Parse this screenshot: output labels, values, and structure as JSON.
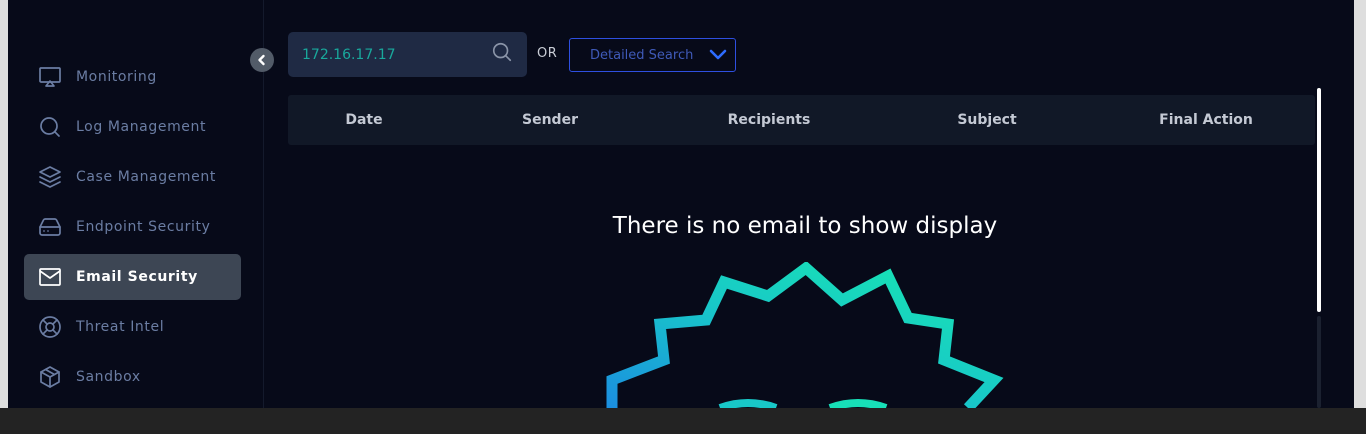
{
  "sidebar": {
    "items": [
      {
        "label": "Monitoring",
        "icon": "monitor-icon",
        "active": false
      },
      {
        "label": "Log Management",
        "icon": "search-icon",
        "active": false
      },
      {
        "label": "Case Management",
        "icon": "layers-icon",
        "active": false
      },
      {
        "label": "Endpoint Security",
        "icon": "hard-drive-icon",
        "active": false
      },
      {
        "label": "Email Security",
        "icon": "mail-icon",
        "active": true
      },
      {
        "label": "Threat Intel",
        "icon": "lifebuoy-icon",
        "active": false
      },
      {
        "label": "Sandbox",
        "icon": "box-icon",
        "active": false
      }
    ],
    "collapse_icon": "chevron-left-icon"
  },
  "search": {
    "value": "172.16.17.17",
    "icon": "search-icon"
  },
  "or_label": "OR",
  "detailed_search": {
    "label": "Detailed Search",
    "icon": "chevron-down-icon"
  },
  "table": {
    "columns": [
      "Date",
      "Sender",
      "Recipients",
      "Subject",
      "Final Action"
    ]
  },
  "empty_state": {
    "message": "There is no email to show display"
  },
  "colors": {
    "background": "#070a19",
    "sidebar_active": "#3d4654",
    "accent_blue": "#2e4fe0",
    "search_text": "#19a89c",
    "illustration_start": "#1b8fe0",
    "illustration_end": "#17e8b0"
  }
}
